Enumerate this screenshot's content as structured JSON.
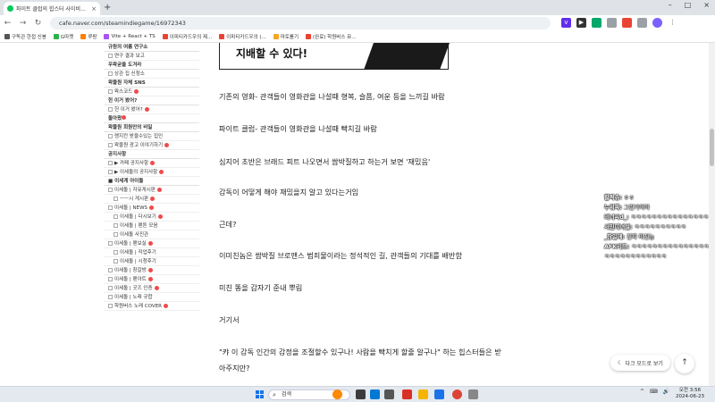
{
  "browser": {
    "tab_title": "파이트 클럽의 힙스터 사이비…",
    "tab_close": "×",
    "new_tab": "+",
    "url": "cafe.naver.com/steamindiegame/16972343",
    "window_controls": [
      "–",
      "□",
      "×"
    ],
    "nav": {
      "back": "←",
      "forward": "→",
      "reload": "↻"
    },
    "bookmarks": [
      "구독관 한접 신봉",
      "G마켓",
      "루팡",
      "Vite + React + TS",
      "이피티카드우의 제...",
      "이피티카드우의 (...",
      "마토롤기",
      "(완료) 학원버스 뮤..."
    ]
  },
  "sidebar": {
    "items": [
      {
        "label": "규원의 여름 연구소",
        "type": "head"
      },
      {
        "label": "연구 결과 보고",
        "type": "item"
      },
      {
        "label": "우왁굳을 도겨라",
        "type": "head"
      },
      {
        "label": "상관 집 신청소",
        "type": "item"
      },
      {
        "label": "왁물원 자체 SNS",
        "type": "head"
      },
      {
        "label": "왁스코드",
        "type": "item",
        "new": true
      },
      {
        "label": "헌 이거 봤어?",
        "type": "head"
      },
      {
        "label": "헌 이거 봤어?",
        "type": "item",
        "new": true
      },
      {
        "label": "돌아왔",
        "type": "head",
        "new": true
      },
      {
        "label": "왁물원 회원만의 비밀",
        "type": "head"
      },
      {
        "label": "랭지칸 받을수있는 집인",
        "type": "item"
      },
      {
        "label": "왁물원 광고 이야기하기",
        "type": "item",
        "new": true
      },
      {
        "label": "공지사항",
        "type": "head"
      },
      {
        "label": "▶ 카페 공지사항",
        "type": "item",
        "new": true
      },
      {
        "label": "▶ 이세돌의 공지사항",
        "type": "item",
        "new": true
      },
      {
        "label": "■ 이세계 아이돌",
        "type": "head"
      },
      {
        "label": "이세돌 | 자유게시판",
        "type": "item",
        "new": true
      },
      {
        "label": "ㅡㅡ시 게시판",
        "type": "sub",
        "new": true
      },
      {
        "label": "이세돌 | NEWS",
        "type": "item",
        "new": true
      },
      {
        "label": "이세돌 | 다시보기",
        "type": "sub",
        "new": true
      },
      {
        "label": "이세돌 | 팬튼 모음",
        "type": "sub"
      },
      {
        "label": "이세돌 사진관",
        "type": "sub"
      },
      {
        "label": "이세돌 | 팬보실",
        "type": "item",
        "new": true
      },
      {
        "label": "이세돌 | 작업후기",
        "type": "sub"
      },
      {
        "label": "이세돌 | 시청후기",
        "type": "sub"
      },
      {
        "label": "이세돌 | 창갈방",
        "type": "item",
        "new": true
      },
      {
        "label": "이세돌 | 팬아트",
        "type": "item",
        "new": true
      },
      {
        "label": "이세돌 | 굿즈 인증",
        "type": "item",
        "new": true
      },
      {
        "label": "이세돌 | 노래 규합",
        "type": "item"
      },
      {
        "label": "학원버스 노래 COVER",
        "type": "item",
        "new": true
      }
    ]
  },
  "article": {
    "image_caption": "지배할 수 있다!",
    "paragraphs": [
      "기존의 영화- 관객들이 영화관을 나설때 형복, 슬픔, 여운 등을 느끼길 바람",
      "파이트 클럽- 관객들이 영화관을 나설때 빡치길 바람",
      "심지어 초반은 브래드 피트 나오면서 쌈박질하고 하는거 보면 '재밌음'",
      "감독이 어떻게 해야 재밌을지 알고 있다는거임",
      "근데?",
      "이미친놈은 쌈박질 브로맨스 범죄물이라는 정석적인 길, 관객들의 기대를 배반함",
      "미친 똥을 갑자기 준내 뿌림",
      "거기서",
      "\"캬 이 감독 인간의 감정을 조절할수 있구나! 사람을 빡치게 할줄 알구나\" 하는 힙스터들은 받",
      "아주지만?"
    ]
  },
  "chat": [
    {
      "user": "할짝츄:",
      "text": "ㅎㅎ"
    },
    {
      "user": "누워짜:",
      "text": "그린가이아"
    },
    {
      "user": "비너씨d_:",
      "text": "ㅋㅋㅋㅋㅋㅋㅋㅋㅋㅋㅋㅋㅋㅋㅋㅋ"
    },
    {
      "user": "서민띠녀설:",
      "text": "ㅋㅋㅋㅋㅋㅋㅋㅋㅋㅋ"
    },
    {
      "user": "_참일에:",
      "text": "진짜 미친놈"
    },
    {
      "user": "AFK키드:",
      "text": "ㅋㅋㅋㅋㅋㅋㅋㅋㅋㅋㅋㅋㅋㅋㅋㅋㅋㅋㅋㅋㅋㅋㅋㅋㅋㅋㅋㅋ"
    }
  ],
  "floating": {
    "dark_mode_label": "다크 모드로 보기",
    "dark_mode_icon": "moon-icon",
    "top_icon": "↑"
  },
  "taskbar": {
    "search_placeholder": "검색",
    "tray_icons": [
      "^",
      "⌨",
      "🔊"
    ],
    "time": "오전 3:56",
    "date": "2024-06-23"
  },
  "colors": {
    "naver_green": "#03c75a",
    "new_badge": "#f04a4a",
    "start_blue": "#1a73e8"
  }
}
